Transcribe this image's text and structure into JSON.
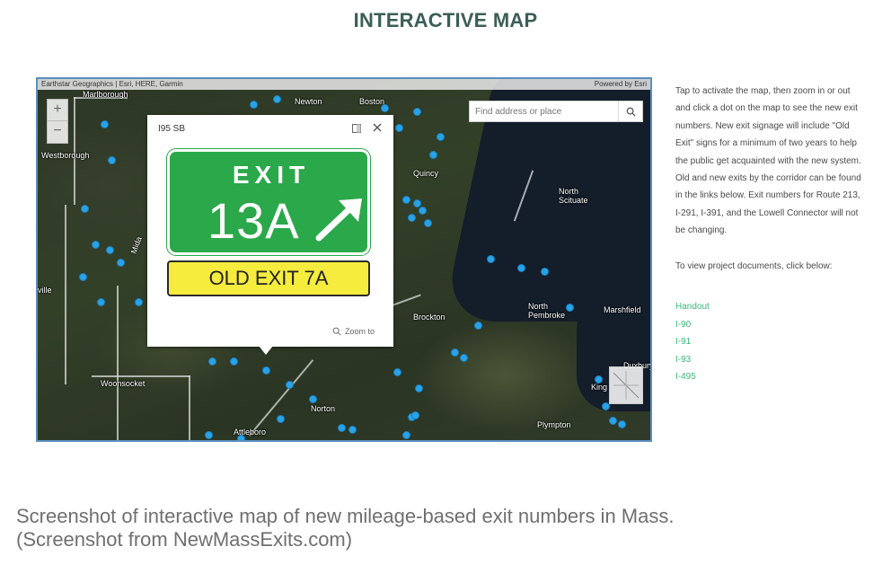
{
  "page": {
    "title": "INTERACTIVE MAP"
  },
  "map": {
    "attribution_left": "Earthstar Geographics | Esri, HERE, Garmin",
    "attribution_right": "Powered by Esri",
    "zoom_in": "+",
    "zoom_out": "−",
    "search": {
      "placeholder": "Find address or place",
      "icon": "search-icon"
    },
    "places": [
      "Marlborough",
      "Newton",
      "Boston",
      "Westborough",
      "Quincy",
      "North Scituate",
      "Brockton",
      "North Pembroke",
      "Marshfield",
      "Woonsocket",
      "Norton",
      "Attleboro",
      "Plympton",
      "Duxbury",
      "King",
      "ville",
      "Mida"
    ],
    "popup": {
      "title": "I95 SB",
      "dock_icon": "dock-icon",
      "close_icon": "close-icon",
      "sign_exit_label": "EXIT",
      "sign_exit_number": "13A",
      "sign_old_exit": "OLD EXIT 7A",
      "zoom_to": "Zoom to",
      "sign_green_color": "#2aa84a",
      "sign_yellow_color": "#f5ec3e"
    },
    "dot_color": "#29a3e6"
  },
  "sidebar": {
    "instructions": "Tap to activate the map, then zoom in or out and click a dot on the map to see the new exit numbers. New exit signage will include \"Old Exit\" signs for a minimum of two years to help the public get acquainted with the new system. Old and new exits by the corridor can be found in the links below.  Exit numbers for Route 213, I-291, I-391, and the Lowell Connector will not be changing.",
    "documents_prompt": "To view project documents, click below:",
    "links": [
      "Handout",
      "I-90",
      "I-91",
      "I-93",
      "I-495"
    ],
    "link_color": "#3cb878"
  },
  "caption": {
    "line1": "Screenshot of interactive map of new mileage-based exit numbers in Mass.",
    "line2": "(Screenshot from NewMassExits.com)"
  }
}
